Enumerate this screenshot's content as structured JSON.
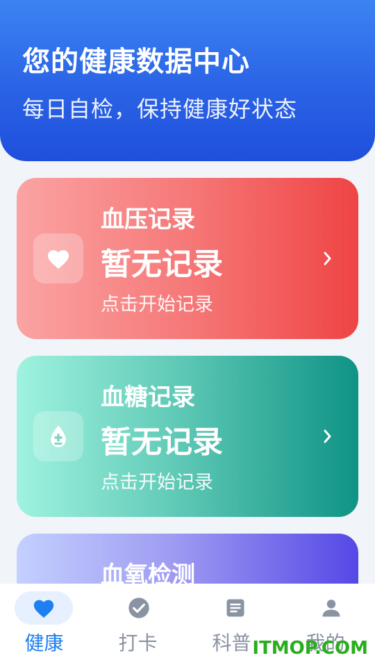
{
  "header": {
    "title": "您的健康数据中心",
    "subtitle": "每日自检，保持健康好状态"
  },
  "cards": [
    {
      "label": "血压记录",
      "value": "暂无记录",
      "hint": "点击开始记录",
      "icon": "heart-icon"
    },
    {
      "label": "血糖记录",
      "value": "暂无记录",
      "hint": "点击开始记录",
      "icon": "blood-drop-icon"
    },
    {
      "label": "血氧检测",
      "icon": "oxygen-icon"
    }
  ],
  "nav": {
    "items": [
      {
        "label": "健康",
        "icon": "heart-icon",
        "active": true
      },
      {
        "label": "打卡",
        "icon": "check-circle-icon"
      },
      {
        "label": "科普",
        "icon": "article-icon"
      },
      {
        "label": "我的",
        "icon": "person-icon"
      }
    ]
  },
  "watermark": "ITMOP.COM",
  "colors": {
    "header": "#2a63e6",
    "active_nav": "#1e7ff0",
    "inactive_nav": "#8a93a2",
    "bp_card": "#ef4444",
    "bg_card": "#0f9385",
    "bo_card": "#5548e6"
  }
}
